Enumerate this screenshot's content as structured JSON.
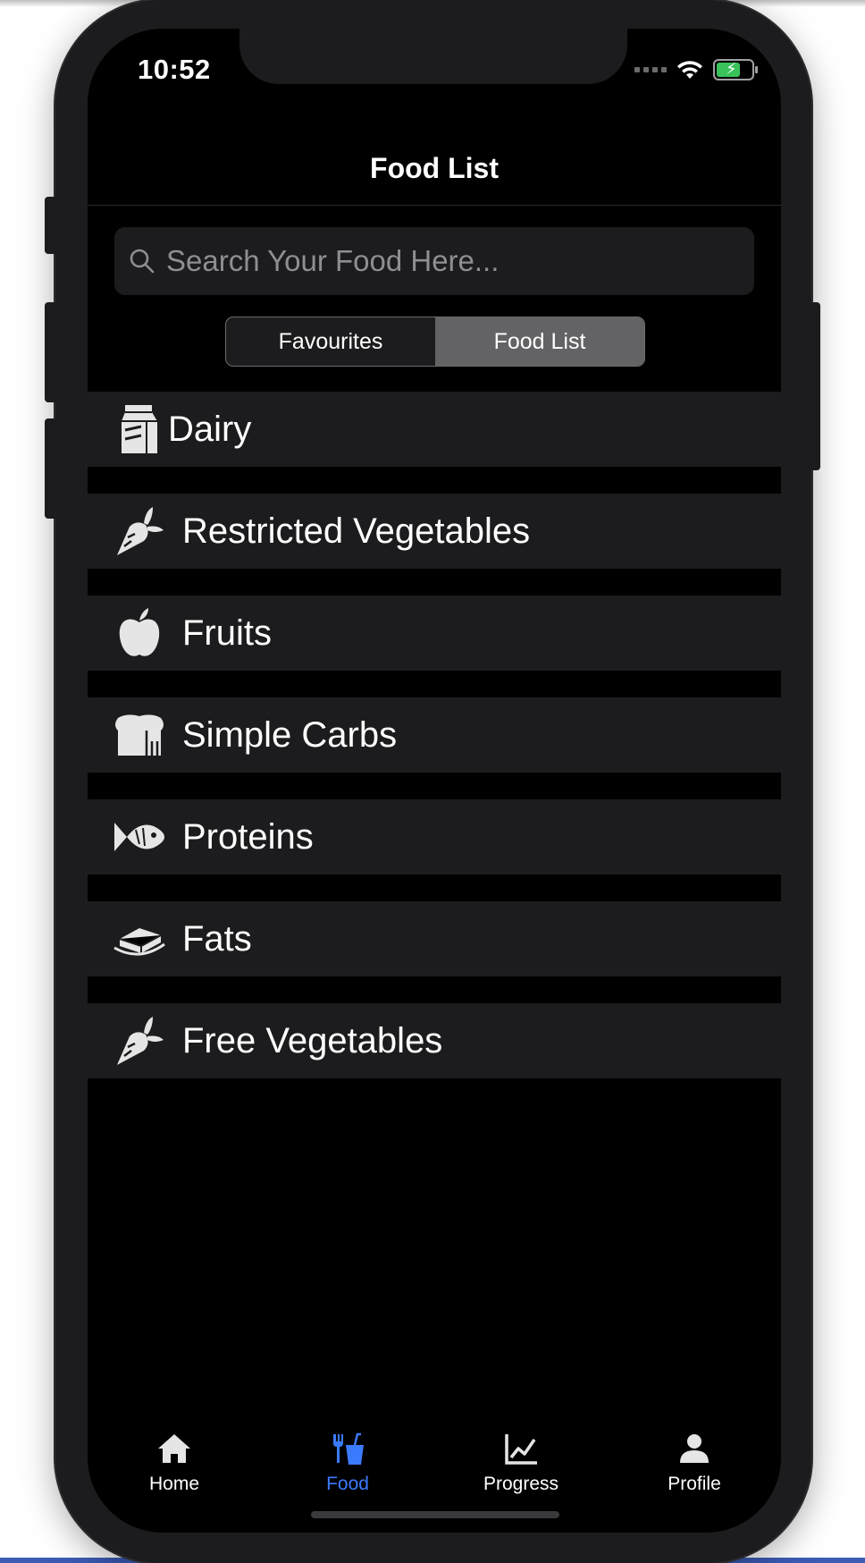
{
  "status_bar": {
    "time": "10:52"
  },
  "nav": {
    "title": "Food List"
  },
  "search": {
    "placeholder": "Search Your Food Here..."
  },
  "segments": [
    {
      "label": "Favourites",
      "selected": false
    },
    {
      "label": "Food List",
      "selected": true
    }
  ],
  "categories": [
    {
      "label": "Dairy",
      "icon": "milk-carton-icon"
    },
    {
      "label": "Restricted Vegetables",
      "icon": "carrot-icon"
    },
    {
      "label": "Fruits",
      "icon": "apple-icon"
    },
    {
      "label": "Simple Carbs",
      "icon": "bread-icon"
    },
    {
      "label": "Proteins",
      "icon": "fish-icon"
    },
    {
      "label": "Fats",
      "icon": "butter-icon"
    },
    {
      "label": "Free Vegetables",
      "icon": "carrot-icon"
    }
  ],
  "tabs": [
    {
      "label": "Home",
      "icon": "home-icon",
      "active": false
    },
    {
      "label": "Food",
      "icon": "utensils-drink-icon",
      "active": true
    },
    {
      "label": "Progress",
      "icon": "chart-line-icon",
      "active": false
    },
    {
      "label": "Profile",
      "icon": "user-icon",
      "active": false
    }
  ],
  "colors": {
    "accent": "#3b7bff",
    "background": "#000000",
    "row": "#1c1c1e"
  }
}
